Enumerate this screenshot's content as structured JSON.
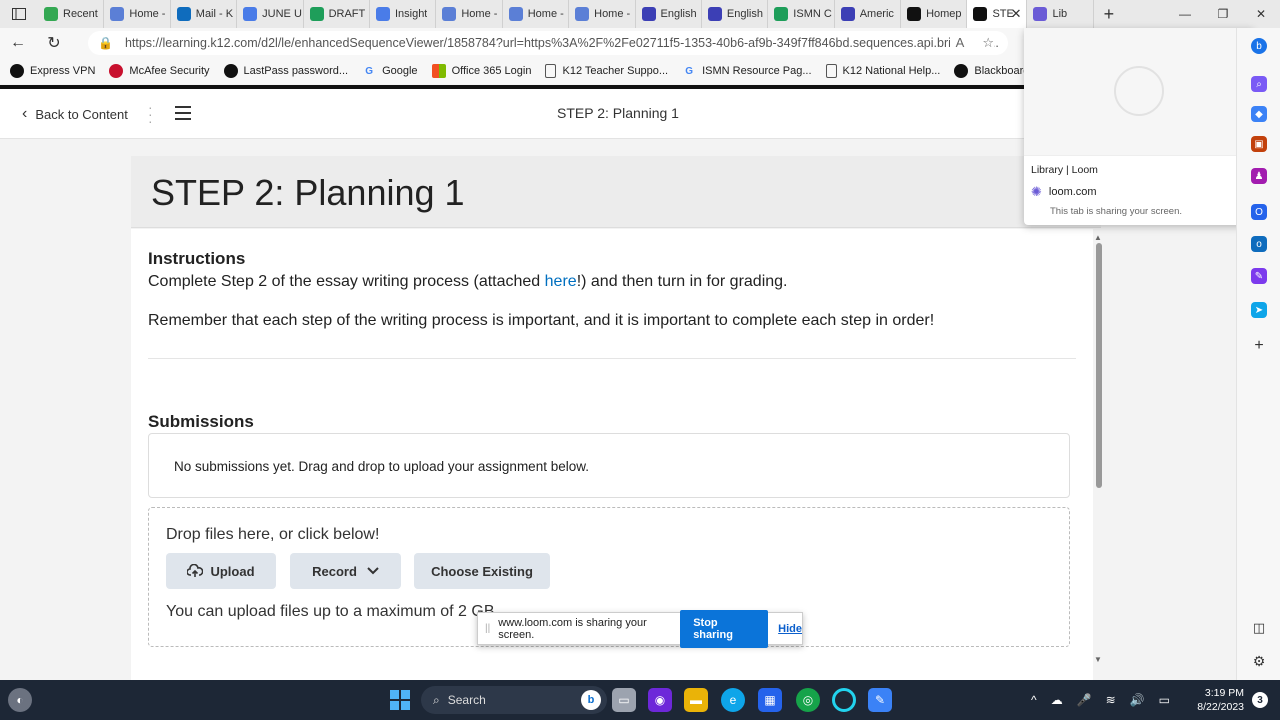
{
  "browser": {
    "tabs": [
      {
        "label": "Recent",
        "icon": "google-drive-icon",
        "color": "#34a853"
      },
      {
        "label": "Home -",
        "icon": "globe-icon",
        "color": "#5b7fd6"
      },
      {
        "label": "Mail - K",
        "icon": "outlook-icon",
        "color": "#0f6cbd"
      },
      {
        "label": "JUNE U",
        "icon": "google-docs-icon",
        "color": "#4a7ce8"
      },
      {
        "label": "DRAFT",
        "icon": "google-sheets-icon",
        "color": "#1e9e5a"
      },
      {
        "label": "Insight",
        "icon": "google-docs-icon",
        "color": "#4a7ce8"
      },
      {
        "label": "Home -",
        "icon": "globe-icon",
        "color": "#5b7fd6"
      },
      {
        "label": "Home -",
        "icon": "globe-icon",
        "color": "#5b7fd6"
      },
      {
        "label": "Home -",
        "icon": "globe-icon",
        "color": "#5b7fd6"
      },
      {
        "label": "English",
        "icon": "app-icon",
        "color": "#3c3fb5"
      },
      {
        "label": "English",
        "icon": "app-icon",
        "color": "#3c3fb5"
      },
      {
        "label": "ISMN C",
        "icon": "google-sheets-icon",
        "color": "#1e9e5a"
      },
      {
        "label": "Americ",
        "icon": "app-icon",
        "color": "#3c3fb5"
      },
      {
        "label": "Homep",
        "icon": "d2l-icon",
        "color": "#111111"
      },
      {
        "label": "STE",
        "icon": "d2l-icon",
        "color": "#111111",
        "active": true
      },
      {
        "label": "Lib",
        "icon": "loom-icon",
        "color": "#6b5bd6"
      }
    ],
    "url": "https://learning.k12.com/d2l/le/enhancedSequenceViewer/1858784?url=https%3A%2F%2Fe02711f5-1353-40b6-af9b-349f7ff846bd.sequences.api.brightspa...",
    "bookmarks": [
      {
        "label": "Express VPN",
        "icon": "hp-icon"
      },
      {
        "label": "McAfee Security",
        "icon": "mcafee-icon"
      },
      {
        "label": "LastPass password...",
        "icon": "lastpass-icon"
      },
      {
        "label": "Google",
        "icon": "google-icon"
      },
      {
        "label": "Office 365 Login",
        "icon": "microsoft-icon"
      },
      {
        "label": "K12 Teacher Suppo...",
        "icon": "page-icon"
      },
      {
        "label": "ISMN Resource Pag...",
        "icon": "google-icon"
      },
      {
        "label": "K12 National Help...",
        "icon": "page-icon"
      },
      {
        "label": "Blackboard Support...",
        "icon": "blackboard-icon"
      }
    ]
  },
  "nav": {
    "back_label": "Back to Content",
    "title": "STEP 2: Planning 1"
  },
  "content": {
    "heading": "STEP 2: Planning 1",
    "instructions_heading": "Instructions",
    "instr_pre": "Complete Step 2 of the essay writing process (attached ",
    "instr_link": "here",
    "instr_post": "!) and then turn in for grading.",
    "instr_2": "Remember that each step of the writing process is important, and it is important to complete each step in order!",
    "submissions_heading": "Submissions",
    "no_submissions": "No submissions yet. Drag and drop to upload your assignment below.",
    "drop_text": "Drop files here, or click below!",
    "upload_label": "Upload",
    "record_label": "Record",
    "choose_existing_label": "Choose Existing",
    "max_size": "You can upload files up to a maximum of 2 GB."
  },
  "sharebar": {
    "text": "www.loom.com is sharing your screen.",
    "stop_label": "Stop sharing",
    "hide_label": "Hide"
  },
  "popover": {
    "title": "Library | Loom",
    "site": "loom.com",
    "note": "This tab is sharing your screen."
  },
  "taskbar": {
    "search_placeholder": "Search",
    "time": "3:19 PM",
    "date": "8/22/2023",
    "notifications": "3"
  }
}
